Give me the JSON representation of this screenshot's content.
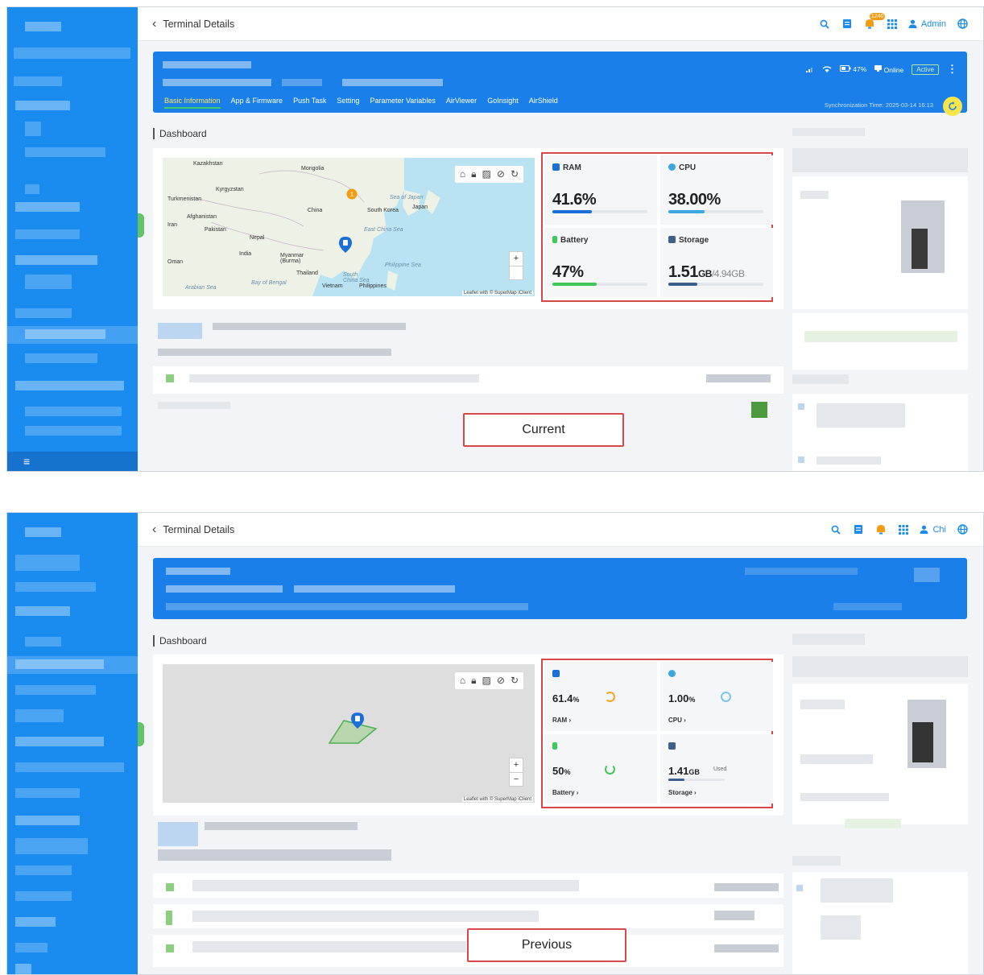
{
  "current": {
    "title": "Terminal Details",
    "callout": "Current",
    "notifications_badge": "1240",
    "user_name": "Admin",
    "tabs": [
      "Basic Information",
      "App & Firmware",
      "Push Task",
      "Setting",
      "Parameter Variables",
      "AirViewer",
      "GoInsight",
      "AirShield"
    ],
    "status": {
      "battery": "47%",
      "online": "Online",
      "active": "Active"
    },
    "sync_time": "Synchronization Time: 2025-03-14 16:13",
    "dashboard_title": "Dashboard",
    "map": {
      "attribution": "Leaflet with © SuperMap iClient",
      "labels": [
        "Kazakhstan",
        "Mongolia",
        "Kyrgyzstan",
        "Turkmenistan",
        "China",
        "Sea of Japan",
        "Japan",
        "South Korea",
        "Afghanistan",
        "Iran",
        "Pakistan",
        "East China Sea",
        "Nepal",
        "India",
        "Myanmar (Burma)",
        "Oman",
        "Thailand",
        "Bay of Bengal",
        "Arabian Sea",
        "Vietnam",
        "Philippines",
        "South China Sea",
        "Philippine Sea"
      ],
      "zoom_in": "+"
    },
    "metrics": {
      "ram": {
        "label": "RAM",
        "value": "41.6%",
        "fraction": 0.416,
        "color": "#1a6fd8"
      },
      "cpu": {
        "label": "CPU",
        "value": "38.00%",
        "fraction": 0.38,
        "color": "#3ba7e0"
      },
      "battery": {
        "label": "Battery",
        "value": "47%",
        "fraction": 0.47,
        "color": "#3ec95a"
      },
      "storage": {
        "label": "Storage",
        "value": "1.51",
        "unit": "GB",
        "total": "/4.94GB",
        "fraction": 0.306,
        "color": "#3d5f8a"
      }
    }
  },
  "previous": {
    "title": "Terminal Details",
    "callout": "Previous",
    "user_name": "Chi",
    "dashboard_title": "Dashboard",
    "map": {
      "attribution": "Leaflet with © SuperMap iClient",
      "zoom_in": "+",
      "zoom_out": "−"
    },
    "metrics": {
      "ram": {
        "label": "RAM",
        "value": "61.4",
        "unit": "%",
        "ring_color": "#f5a623",
        "icon_color": "#1a6fd8"
      },
      "cpu": {
        "label": "CPU",
        "value": "1.00",
        "unit": "%",
        "ring_color": "#7cc6ea",
        "icon_color": "#3ba7e0"
      },
      "battery": {
        "label": "Battery",
        "value": "50",
        "unit": "%",
        "ring_color": "#3ec95a",
        "icon_color": "#3ec95a"
      },
      "storage": {
        "label": "Storage",
        "value": "1.41",
        "unit": "GB",
        "used": "Used",
        "fraction": 0.285,
        "icon_color": "#3d5f8a"
      }
    }
  },
  "icons": {
    "back": "‹",
    "search": "⚲",
    "doc": "▤",
    "bell": "🔔",
    "grid": "⋮⋮⋮",
    "user": "👤",
    "globe": "⊕",
    "more": "⋮",
    "menu": "≡"
  }
}
